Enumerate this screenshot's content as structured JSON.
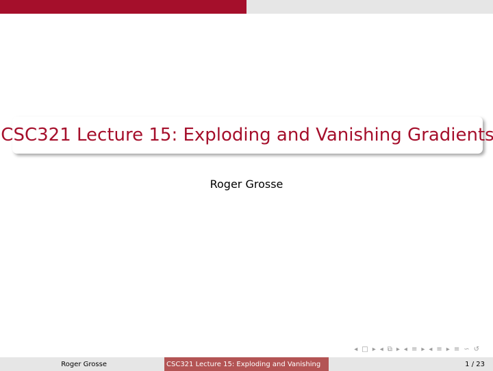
{
  "slide": {
    "title": "CSC321 Lecture 15: Exploding and Vanishing Gradients",
    "author": "Roger Grosse"
  },
  "footer": {
    "author": "Roger Grosse",
    "title": "CSC321 Lecture 15: Exploding and Vanishing",
    "page": "1 / 23"
  },
  "colors": {
    "accent": "#a50f2b",
    "footer_center_bg": "#b35454",
    "bar_gray": "#e6e6e6"
  },
  "nav_icons": [
    "prev-frame-icon",
    "frame-icon",
    "next-frame-icon",
    "prev-subsection-icon",
    "subsection-icon",
    "next-subsection-icon",
    "prev-section-icon",
    "section-icon",
    "next-section-icon",
    "prev-slide-icon",
    "slide-icon",
    "next-slide-icon",
    "align-icon",
    "search-icon",
    "back-icon"
  ]
}
